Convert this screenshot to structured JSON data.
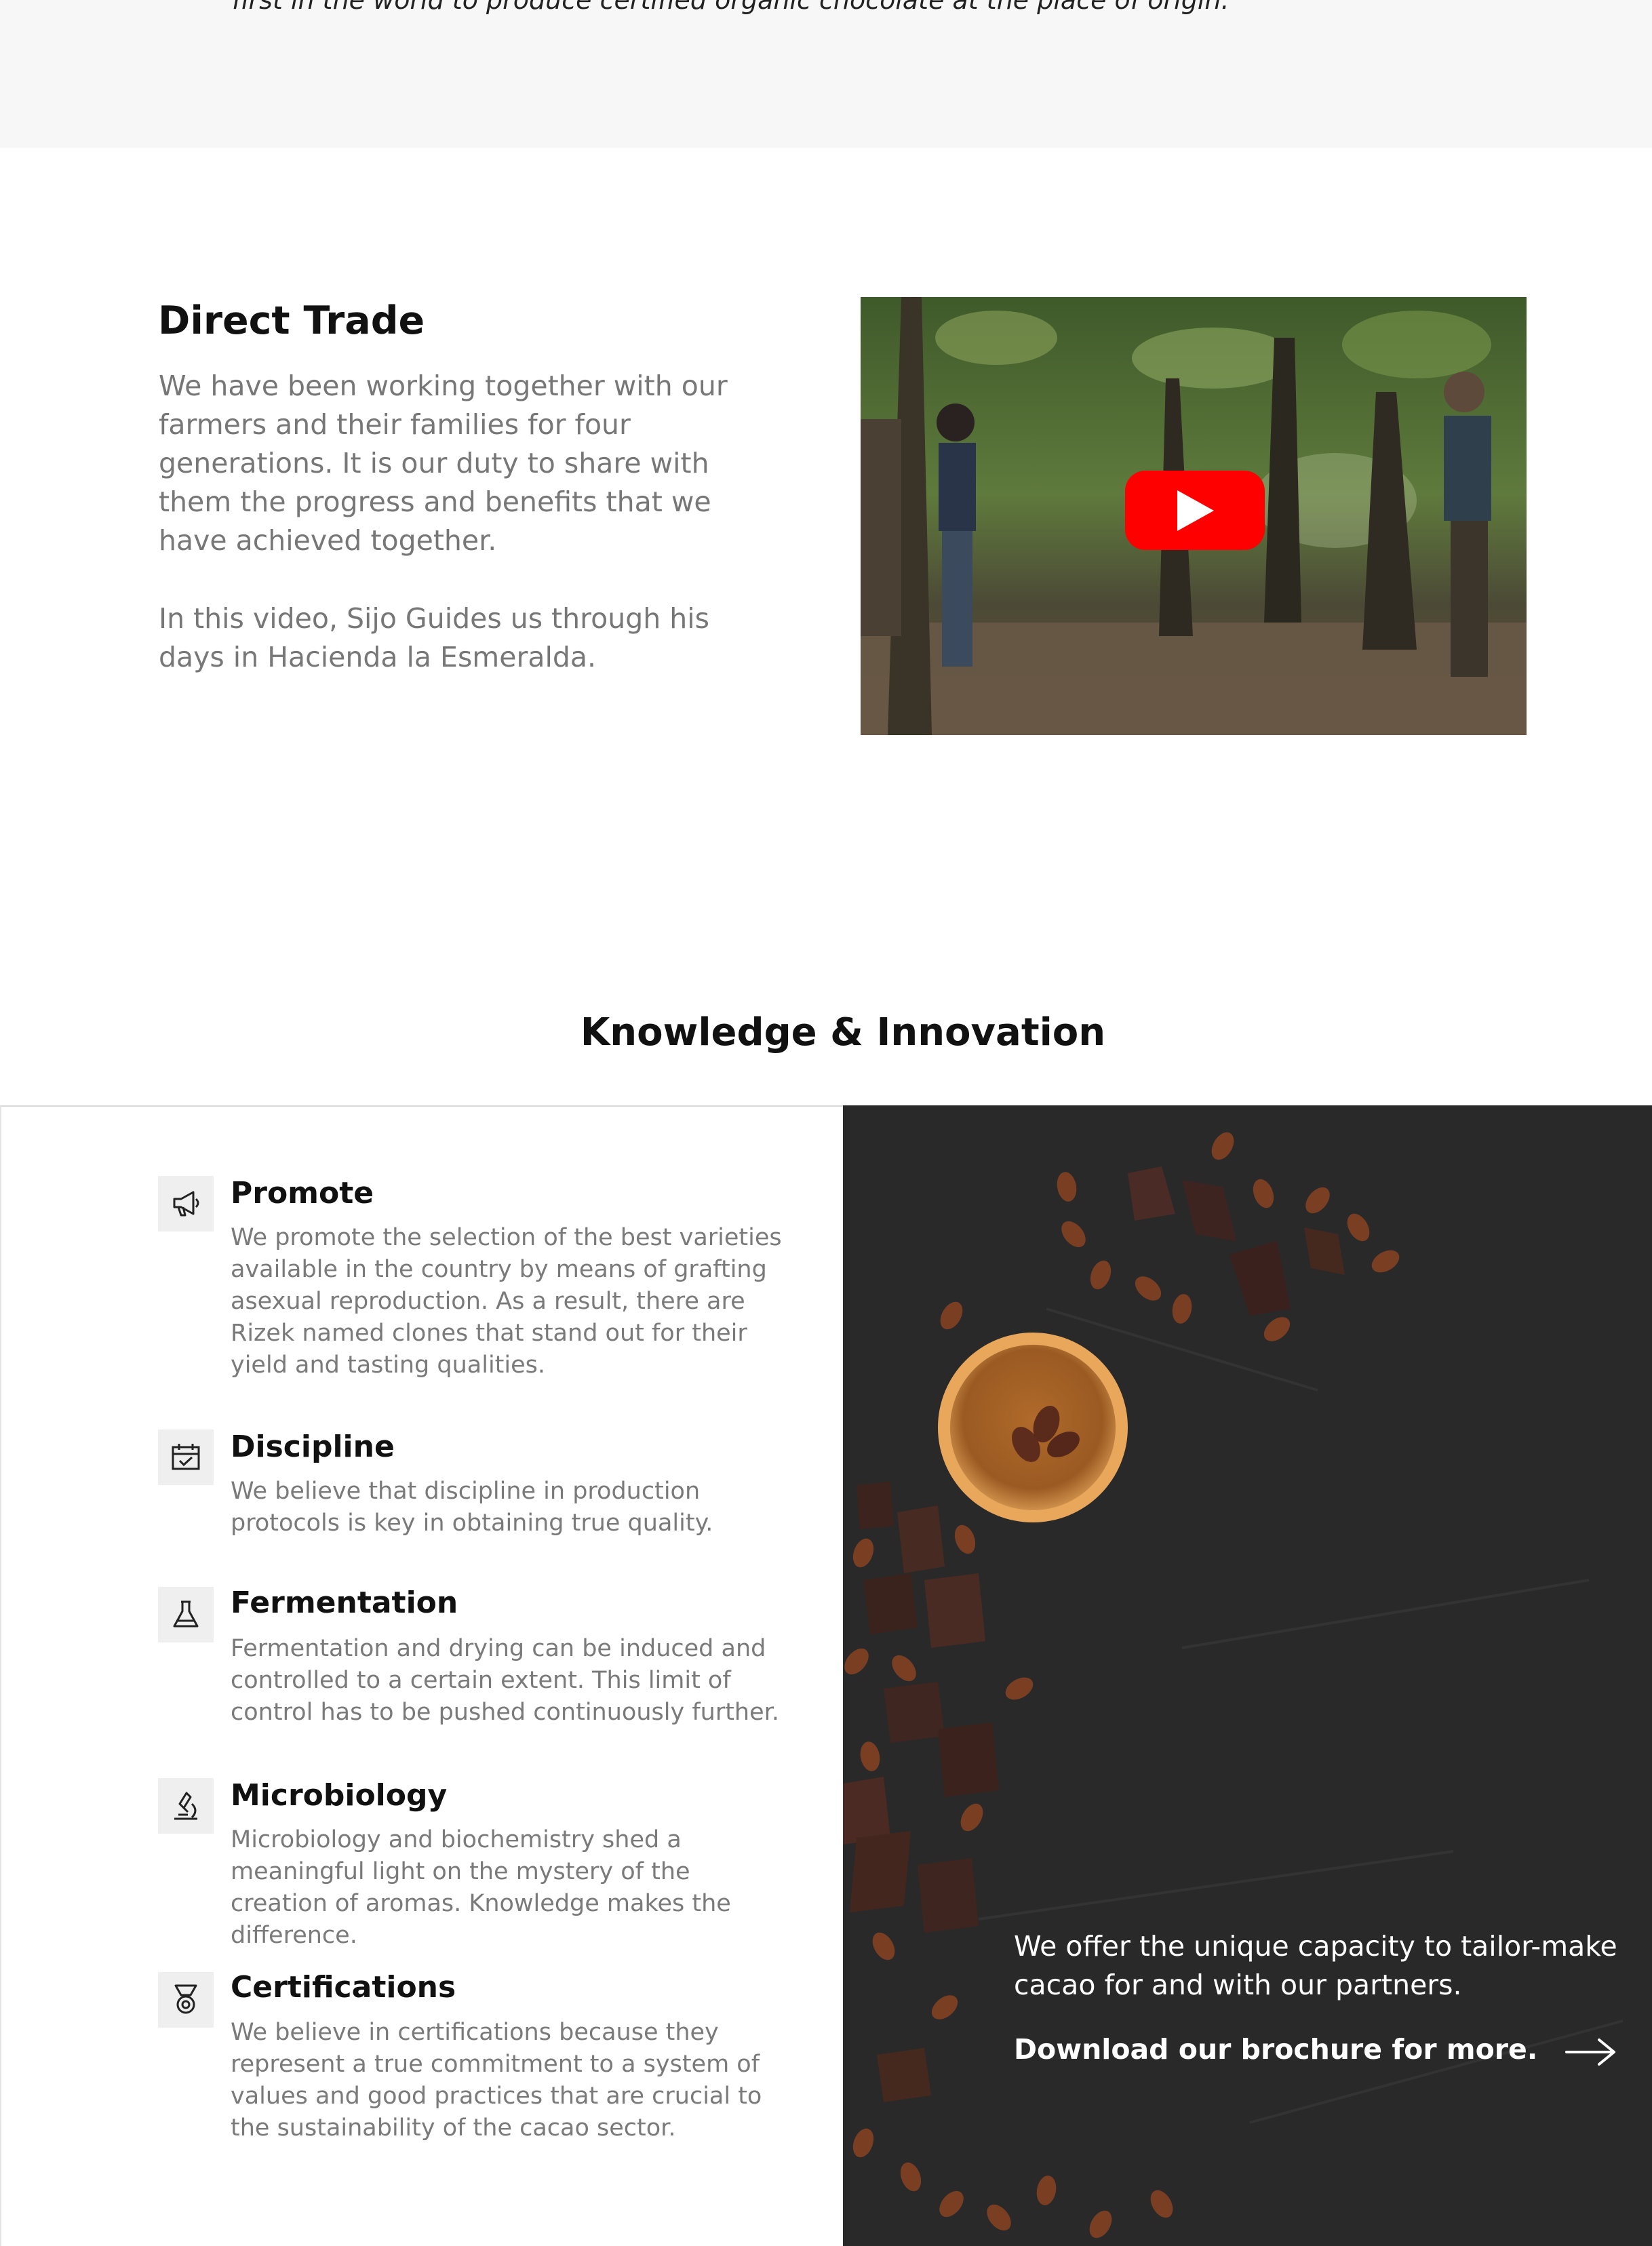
{
  "intro": {
    "quote": "first in the world to produce certified organic chocolate at the place of origin."
  },
  "direct_trade": {
    "title": "Direct Trade",
    "paragraph_1": "We have been working together with our farmers and their families for four generations. It is our duty to share with them the progress and benefits that we have achieved together.",
    "paragraph_2": "In this video, Sijo Guides us through his days in Hacienda la Esmeralda.",
    "video": {
      "play_icon": "play-icon",
      "accent": "#ff0000"
    }
  },
  "knowledge": {
    "title": "Knowledge & Innovation",
    "features": [
      {
        "icon": "megaphone-icon",
        "title": "Promote",
        "description": "We promote the selection of the best varieties available in the country by means of grafting asexual reproduction. As a result, there are Rizek named clones that stand out for their yield and tasting qualities."
      },
      {
        "icon": "calendar-check-icon",
        "title": "Discipline",
        "description": "We believe that discipline in production protocols is key in obtaining true quality."
      },
      {
        "icon": "flask-icon",
        "title": "Fermentation",
        "description": "Fermentation and drying can be induced and controlled to a certain extent. This limit of control has to be pushed continuously further."
      },
      {
        "icon": "microscope-icon",
        "title": "Microbiology",
        "description": "Microbiology and biochemistry shed a meaningful light on the mystery of the creation of aromas. Knowledge makes the difference."
      },
      {
        "icon": "medal-icon",
        "title": "Certifications",
        "description": "We believe in certifications because they represent a true commitment to a system of values and good practices that are crucial to the sustainability of the cacao sector."
      }
    ],
    "offer_text": "We offer the unique capacity to tailor-make cacao for and with our partners.",
    "brochure_link": "Download our brochure for more.",
    "arrow_icon": "arrow-right-icon"
  }
}
